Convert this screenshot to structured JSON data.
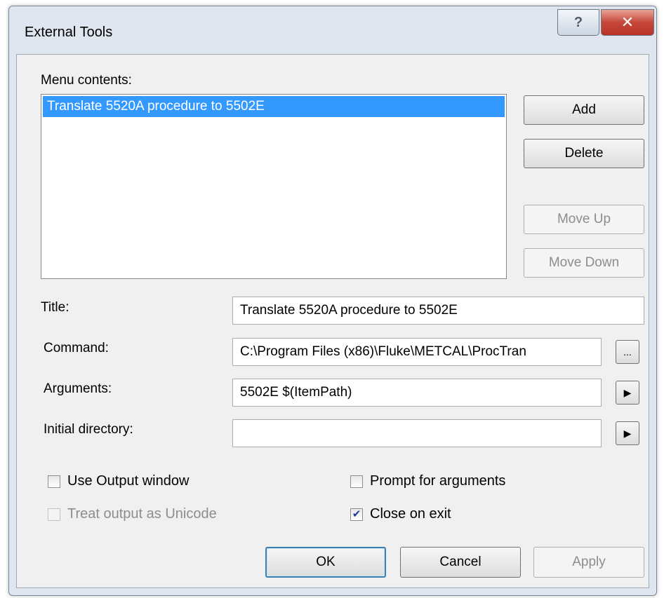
{
  "window": {
    "title": "External Tools",
    "help_label": "?",
    "close_label": "✕"
  },
  "menu_contents": {
    "label": "Menu contents:",
    "items": [
      "Translate 5520A procedure to 5502E"
    ]
  },
  "side_buttons": {
    "add": "Add",
    "delete": "Delete",
    "move_up": "Move Up",
    "move_down": "Move Down"
  },
  "fields": {
    "title_label": "Title:",
    "title_value": "Translate 5520A procedure to 5502E",
    "command_label": "Command:",
    "command_value": "C:\\Program Files (x86)\\Fluke\\METCAL\\ProcTran",
    "browse_label": "...",
    "arguments_label": "Arguments:",
    "arguments_value": "5502E $(ItemPath)",
    "initial_dir_label": "Initial directory:",
    "initial_dir_value": "",
    "arrow_glyph": "▶"
  },
  "checkboxes": {
    "use_output": {
      "label": "Use Output window",
      "checked": false
    },
    "treat_unicode": {
      "label": "Treat output as Unicode",
      "checked": false
    },
    "prompt_args": {
      "label": "Prompt for arguments",
      "checked": false
    },
    "close_on_exit": {
      "label": "Close on exit",
      "checked": true
    }
  },
  "footer": {
    "ok": "OK",
    "cancel": "Cancel",
    "apply": "Apply"
  }
}
